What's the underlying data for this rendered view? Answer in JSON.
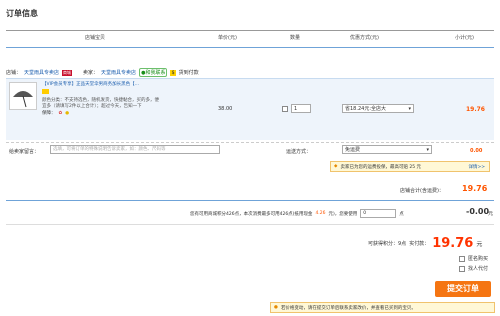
{
  "page": {
    "title": "订单信息"
  },
  "columns": [
    "店铺宝贝",
    "单价(元)",
    "数量",
    "优惠方式(元)",
    "小计(元)"
  ],
  "shop": {
    "label": "店铺：",
    "shop_name": "天堂雨具专卖店",
    "seller_label": "卖家：",
    "seller_name": "天堂雨具专卖店",
    "contact_label": "和我联系",
    "pay_label": "货到付款"
  },
  "item": {
    "title": "【VIP会员专享】正品天堂伞男商务加长黑色【…",
    "desc_1": "颜色分类：不支持选色，随机发货，快捷黏合，买的多，便宜多（请填写2件以上合计）；超过今天，告知一下",
    "promo_label": "保障：",
    "price": "38.00",
    "quantity": "1",
    "discount_select": "省18.24元:全店大",
    "subtotal": "19.76"
  },
  "message": {
    "label": "给卖家留言：",
    "placeholder": "选填，可将订单的特殊说明告诉卖家，如：颜色、尺码等"
  },
  "shipping": {
    "label": "运送方式：",
    "select": "免运费",
    "fee": "0.00",
    "notice": "卖家已为您的运费投保，最高可赔 25 元",
    "notice_link": "详情>>"
  },
  "shop_total": {
    "label": "店铺合计(含运费)：",
    "value": "19.76"
  },
  "points": {
    "text": "您有可用商城积分426点，本次消费最多可用426点(抵用现金",
    "cash": "4.26",
    "text2": "元)，您要使用",
    "input_value": "0",
    "unit": "点",
    "deduct": "-0.00",
    "deduct_unit": "元"
  },
  "summary": {
    "points_earn": "可获得积分：9点",
    "pay_label": "实付款：",
    "pay_value": "19.76",
    "pay_unit": "元"
  },
  "options": [
    {
      "label": "匿名购买"
    },
    {
      "label": "找人代付"
    }
  ],
  "submit_label": "提交订单",
  "footer_notice": {
    "text": "若价格变动，请在提交订单后联系卖家改价，并查看已买到的宝贝。",
    "prefix": "若价格变动"
  }
}
